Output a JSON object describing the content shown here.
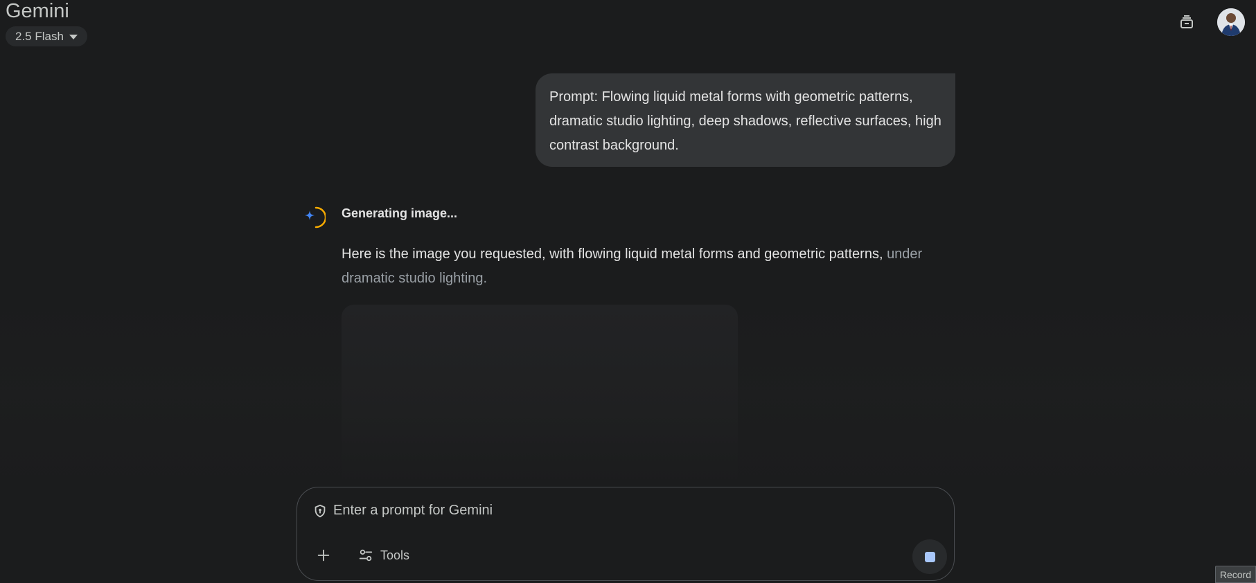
{
  "header": {
    "app_title": "Gemini",
    "model_label": "2.5 Flash",
    "icons": [
      "chat-history-icon",
      "avatar"
    ]
  },
  "user_message": {
    "text": "Prompt: Flowing liquid metal forms with geometric patterns, dramatic studio lighting, deep shadows, reflective surfaces, high contrast background."
  },
  "response": {
    "status": "Generating image...",
    "text_main": "Here is the image you requested, with flowing liquid metal forms and geometric patterns,",
    "text_faded": "under dramatic studio lighting."
  },
  "input": {
    "placeholder": "Enter a prompt for Gemini",
    "tools_label": "Tools"
  },
  "overlay": {
    "record_label": "Record"
  },
  "colors": {
    "background": "#1b1c1d",
    "bubble": "#333537",
    "accent_blue": "#4285f4",
    "accent_orange": "#f9ab00",
    "stop_blue": "#a8c7fa"
  }
}
